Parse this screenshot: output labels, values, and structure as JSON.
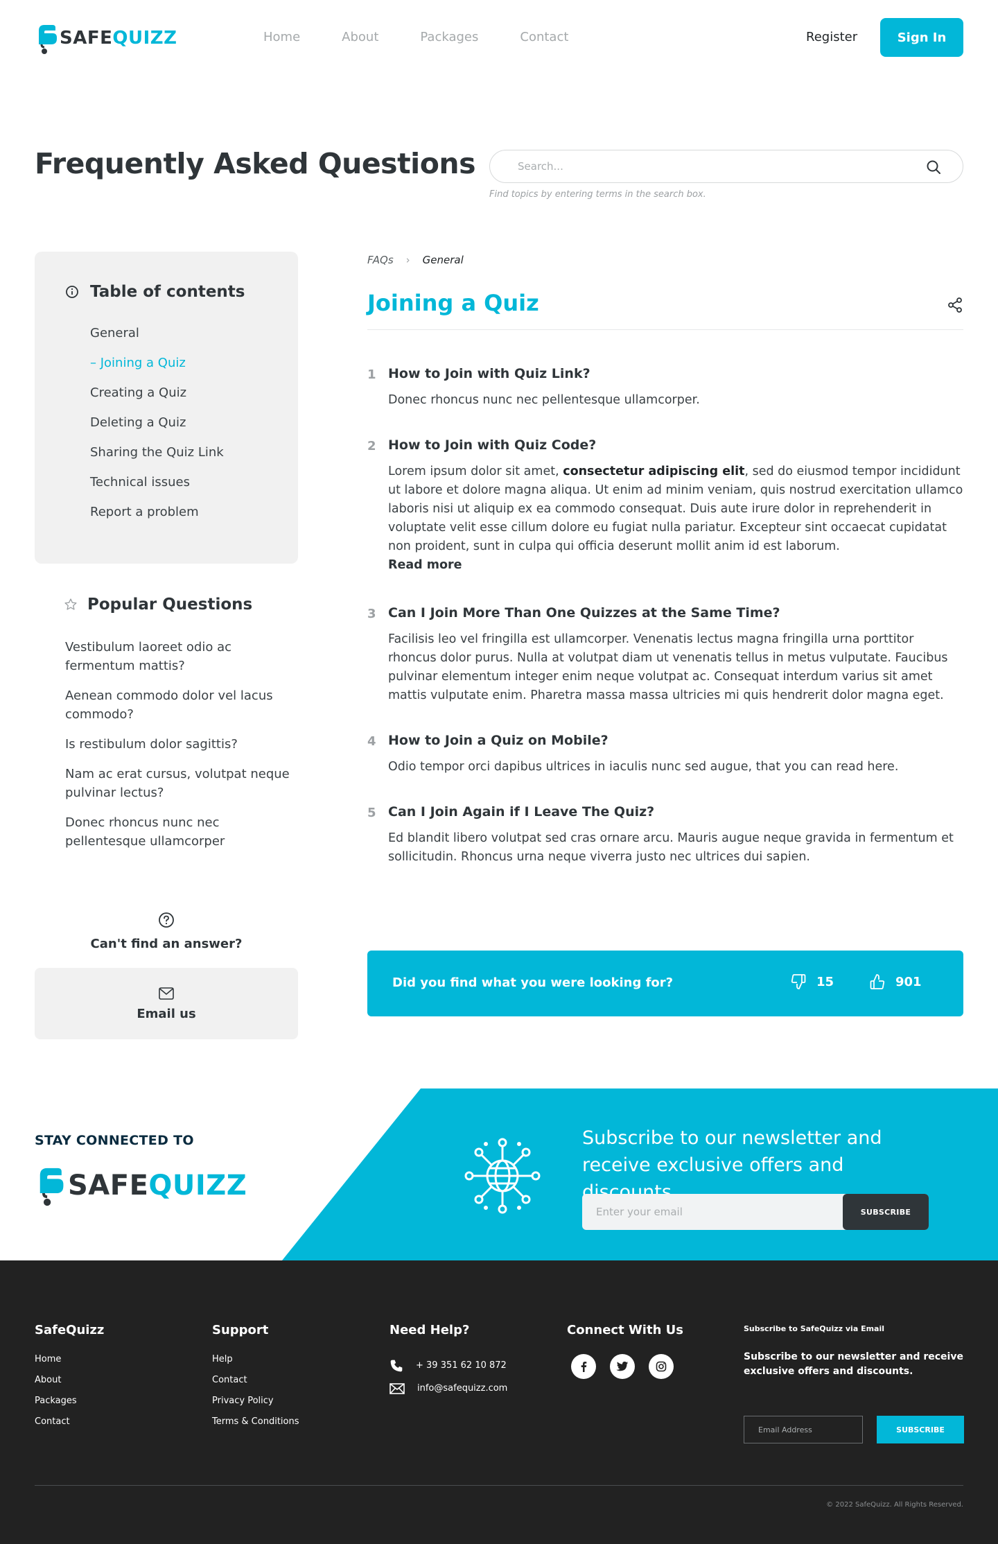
{
  "brand": {
    "safe": "SAFE",
    "quizz": "QUIZZ",
    "accent": "#02b7d8",
    "dark": "#2f3539"
  },
  "nav": {
    "items": [
      "Home",
      "About",
      "Packages",
      "Contact"
    ],
    "register": "Register",
    "signin": "Sign In"
  },
  "hero": {
    "title": "Frequently Asked Questions",
    "search_placeholder": "Search...",
    "search_hint": "Find topics by entering terms in the search box."
  },
  "toc": {
    "icon": "info-circle-icon",
    "title": "Table of contents",
    "items": [
      "General",
      "Joining a Quiz",
      "Creating a Quiz",
      "Deleting a Quiz",
      "Sharing the Quiz Link",
      "Technical issues",
      "Report a problem"
    ],
    "active_index": 1
  },
  "popular": {
    "icon": "star-icon",
    "title": "Popular Questions",
    "items": [
      "Vestibulum laoreet odio ac fermentum mattis?",
      "Aenean commodo dolor vel lacus commodo?",
      "Is restibulum dolor sagittis?",
      "Nam ac erat cursus, volutpat neque pulvinar lectus?",
      "Donec rhoncus nunc nec pellentesque ullamcorper"
    ]
  },
  "help": {
    "cant_find": "Can't find an answer?",
    "email_us": "Email us"
  },
  "breadcrumb": {
    "root": "FAQs",
    "current": "General"
  },
  "section": {
    "title": "Joining a Quiz"
  },
  "faqs": [
    {
      "num": "1",
      "q": "How to Join with Quiz Link?",
      "a": "Donec rhoncus nunc nec pellentesque ullamcorper."
    },
    {
      "num": "2",
      "q": "How to Join with Quiz Code?",
      "a_pre": "Lorem ipsum dolor sit amet, ",
      "a_bold": "consectetur adipiscing elit",
      "a_post": ", sed do eiusmod tempor incididunt ut labore et dolore magna aliqua. Ut enim ad minim veniam, quis nostrud exercitation ullamco laboris nisi ut aliquip ex ea commodo consequat. Duis aute irure dolor in reprehenderit in voluptate velit esse cillum dolore eu fugiat nulla pariatur. Excepteur sint occaecat cupidatat non proident, sunt in culpa qui officia deserunt mollit anim id est laborum.",
      "more": "Read more"
    },
    {
      "num": "3",
      "q": "Can I Join More Than One Quizzes at the Same Time?",
      "a": "Facilisis leo vel fringilla est ullamcorper. Venenatis lectus magna fringilla urna porttitor rhoncus dolor purus. Nulla at volutpat diam ut venenatis tellus in metus vulputate. Faucibus pulvinar elementum integer enim neque volutpat ac. Consequat interdum varius sit amet mattis vulputate enim. Pharetra massa massa ultricies mi quis hendrerit dolor magna eget."
    },
    {
      "num": "4",
      "q": "How to Join a Quiz on Mobile?",
      "a": "Odio tempor orci dapibus ultrices in iaculis nunc sed augue, that you can read here."
    },
    {
      "num": "5",
      "q": "Can I Join Again if I Leave The Quiz?",
      "a": "Ed blandit libero volutpat sed cras ornare arcu. Mauris augue neque gravida in fermentum et sollicitudin. Rhoncus urna neque viverra justo nec ultrices dui sapien."
    }
  ],
  "feedback": {
    "question": "Did you find what you were looking for?",
    "dislikes": "15",
    "likes": "901"
  },
  "newsletter": {
    "stay": "STAY CONNECTED TO",
    "title": "Subscribe to our newsletter and receive exclusive offers and discounts.",
    "placeholder": "Enter your email",
    "button": "SUBSCRIBE"
  },
  "footer": {
    "col1": {
      "title": "SafeQuizz",
      "links": [
        "Home",
        "About",
        "Packages",
        "Contact"
      ]
    },
    "col2": {
      "title": "Support",
      "links": [
        "Help",
        "Contact",
        "Privacy Policy",
        "Terms & Conditions"
      ]
    },
    "col3": {
      "title": "Need Help?",
      "phone": "+ 39 351 62 10 872",
      "email": "info@safequizz.com"
    },
    "col4": {
      "title": "Connect With Us",
      "socials": [
        "facebook-icon",
        "twitter-icon",
        "instagram-icon"
      ]
    },
    "col5": {
      "title": "Subscribe to SafeQuizz via Email",
      "text": "Subscribe to our newsletter and receive exclusive offers and discounts.",
      "placeholder": "Email Address",
      "button": "SUBSCRIBE"
    },
    "copyright": "© 2022 SafeQuizz. All Rights Reserved."
  }
}
